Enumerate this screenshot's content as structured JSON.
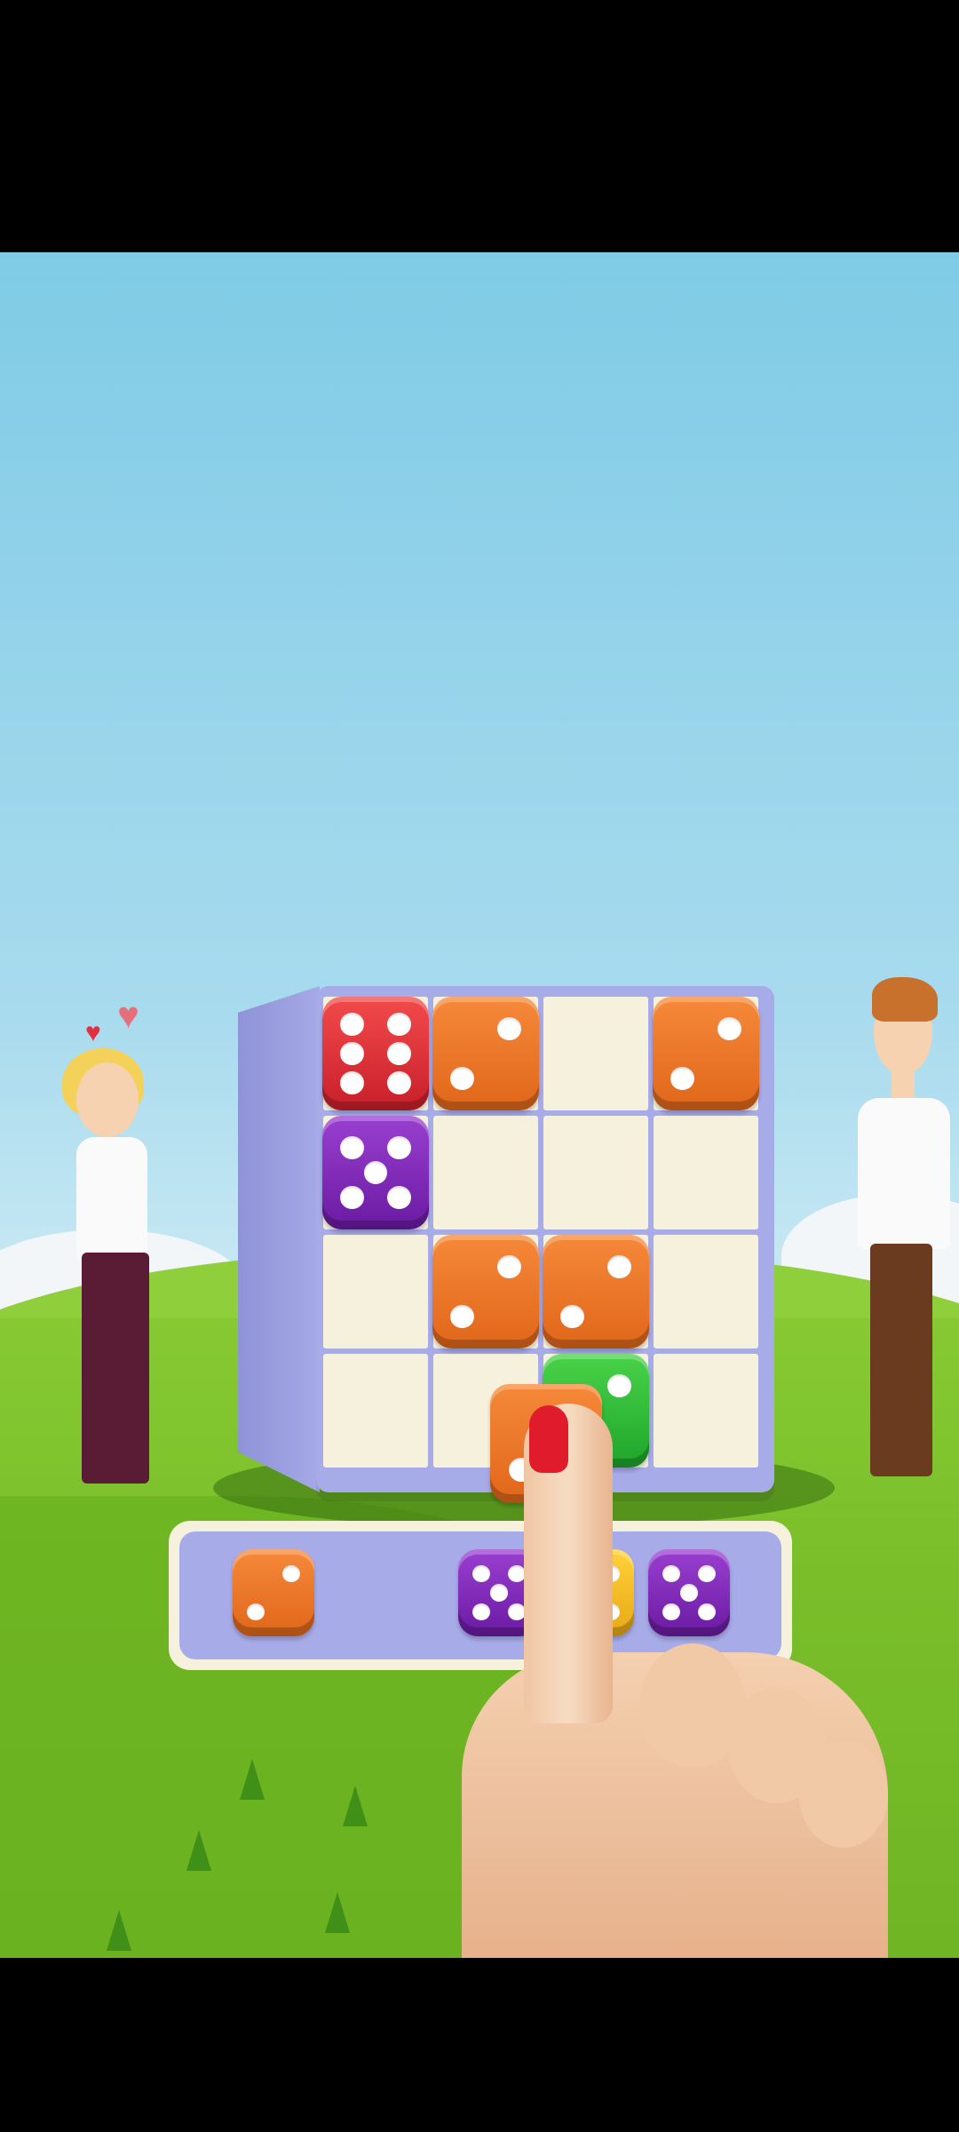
{
  "scene": {
    "colors": {
      "sky": "#7fcbe6",
      "grass": "#7abf2a",
      "board": "#a7abe8",
      "cell": "#f5f1dc"
    }
  },
  "board": {
    "rows": 4,
    "cols": 4,
    "placed_dice": [
      {
        "row": 0,
        "col": 0,
        "color": "red",
        "value": 6
      },
      {
        "row": 0,
        "col": 1,
        "color": "orange",
        "value": 2
      },
      {
        "row": 0,
        "col": 3,
        "color": "orange",
        "value": 2
      },
      {
        "row": 1,
        "col": 0,
        "color": "purple",
        "value": 5
      },
      {
        "row": 2,
        "col": 1,
        "color": "orange",
        "value": 2
      },
      {
        "row": 2,
        "col": 2,
        "color": "orange",
        "value": 2
      },
      {
        "row": 3,
        "col": 2,
        "color": "green",
        "value": 2
      }
    ]
  },
  "dragging_die": {
    "color": "orange",
    "value": 2
  },
  "tray": {
    "dice": [
      {
        "color": "orange",
        "value": 2
      },
      {
        "color": "purple",
        "value": 5
      },
      {
        "color": "yellow",
        "value": 5
      },
      {
        "color": "purple",
        "value": 5
      }
    ]
  },
  "characters": {
    "left": "woman-with-hearts",
    "right": "sad-man"
  },
  "icons": [
    "heart-icon",
    "pointing-hand-icon"
  ]
}
